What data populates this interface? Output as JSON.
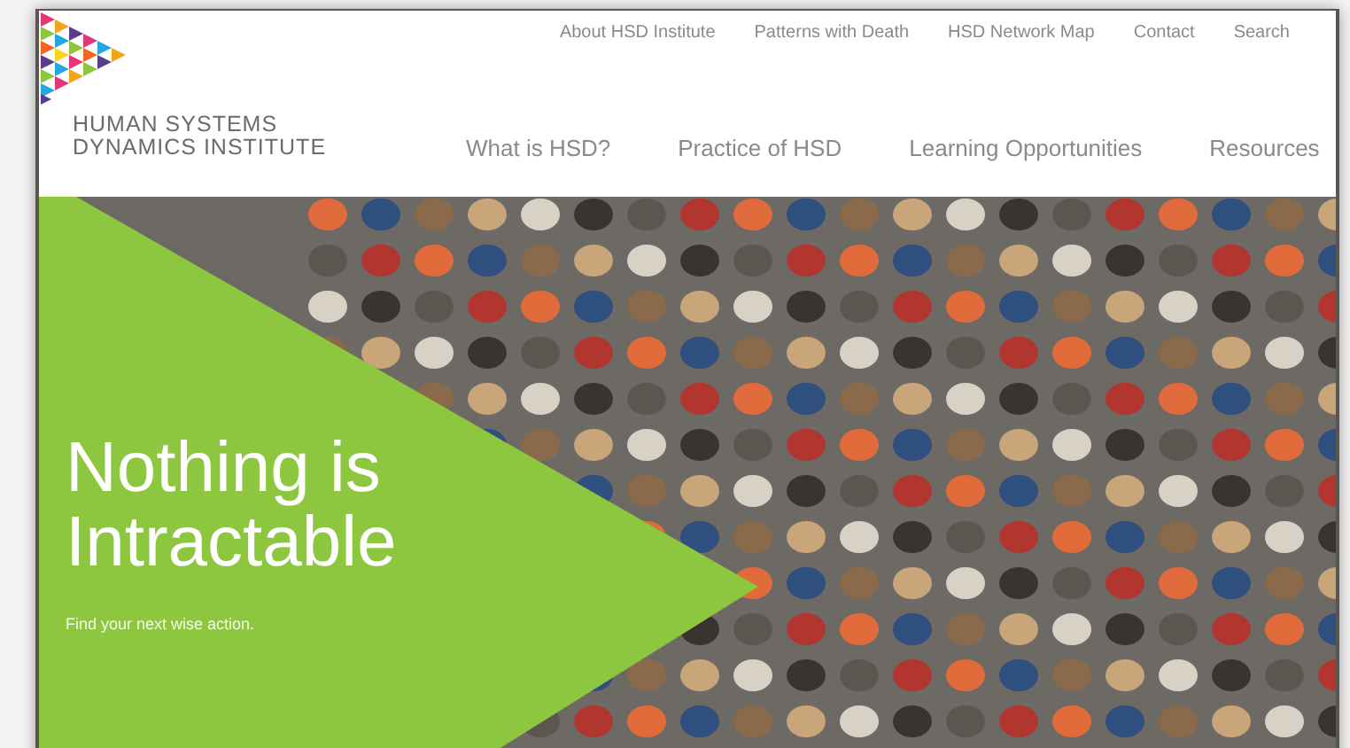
{
  "top_links": [
    "About HSD Institute",
    "Patterns with Death",
    "HSD Network Map",
    "Contact",
    "Search"
  ],
  "brand": {
    "line_1": "HUMAN SYSTEMS",
    "line_2": "DYNAMICS INSTITUTE"
  },
  "main_nav": [
    "What is HSD?",
    "Practice of HSD",
    "Learning Opportunities",
    "Resources"
  ],
  "hero": {
    "kind": "picture",
    "headline": "Nothing is Intractable",
    "subtitle": "Find your next wise action."
  }
}
